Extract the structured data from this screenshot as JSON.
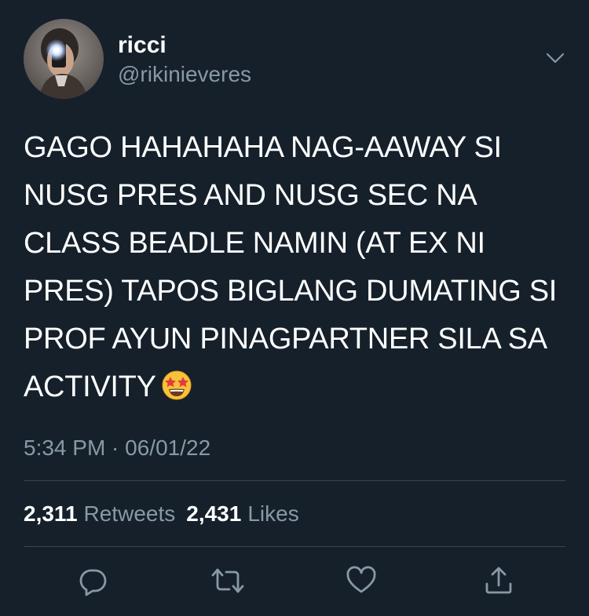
{
  "author": {
    "display_name": "ricci",
    "handle": "@rikinieveres",
    "avatar_icon": "profile-photo"
  },
  "tweet": {
    "lines": [
      "GAGO HAHAHAHA NAG-AAWAY SI",
      "NUSG PRES AND NUSG SEC NA",
      "CLASS BEADLE NAMIN (AT EX NI",
      "PRES) TAPOS BIGLANG DUMATING SI",
      "PROF AYUN PINAGPARTNER SILA SA",
      "ACTIVITY"
    ],
    "emoji": "star-struck-emoji"
  },
  "timestamp": "5:34 PM · 06/01/22",
  "stats": {
    "retweets_count": "2,311",
    "retweets_label": "Retweets",
    "likes_count": "2,431",
    "likes_label": "Likes"
  },
  "actions": [
    "reply-icon",
    "retweet-icon",
    "like-icon",
    "share-icon"
  ],
  "colors": {
    "background": "#15202b",
    "text": "#ffffff",
    "secondary": "#8899a6",
    "divider": "#38444d"
  }
}
